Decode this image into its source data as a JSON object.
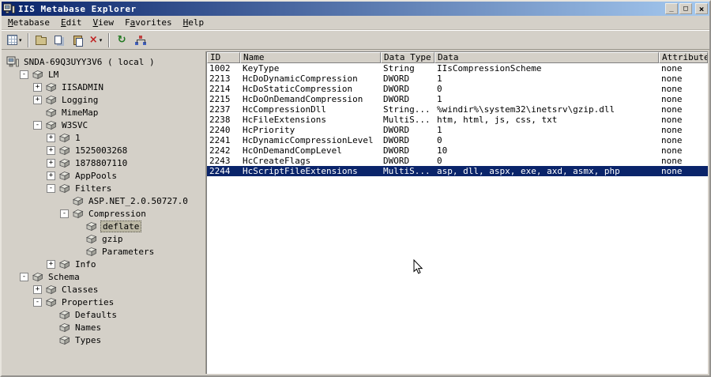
{
  "window": {
    "title": "IIS Metabase Explorer",
    "controls": [
      {
        "name": "minimize",
        "glyph": "_"
      },
      {
        "name": "restore",
        "glyph": "□"
      },
      {
        "name": "close",
        "glyph": "×"
      }
    ]
  },
  "menu": {
    "items": [
      {
        "label": "Metabase",
        "u": 0
      },
      {
        "label": "Edit",
        "u": 0
      },
      {
        "label": "View",
        "u": 0
      },
      {
        "label": "Favorites",
        "u": 1
      },
      {
        "label": "Help",
        "u": 0
      }
    ]
  },
  "toolbar": {
    "buttons": [
      {
        "name": "new-record",
        "icon": "newrecord",
        "dropdown": true
      },
      {
        "type": "separator"
      },
      {
        "name": "open",
        "icon": "folder"
      },
      {
        "name": "copy",
        "icon": "copy"
      },
      {
        "name": "paste",
        "icon": "paste"
      },
      {
        "name": "delete",
        "icon": "delete",
        "glyph": "×",
        "color": "#c02020",
        "dropdown": true
      },
      {
        "type": "separator"
      },
      {
        "name": "refresh",
        "icon": "refresh",
        "glyph": "↻",
        "color": "#207820"
      },
      {
        "name": "network",
        "icon": "network"
      }
    ]
  },
  "tree": {
    "items": [
      {
        "label": "SNDA-69Q3UYY3V6 ( local )",
        "depth": 0,
        "expander": "none",
        "icon": "computer"
      },
      {
        "label": "LM",
        "depth": 1,
        "expander": "minus",
        "icon": "key"
      },
      {
        "label": "IISADMIN",
        "depth": 2,
        "expander": "plus",
        "icon": "key"
      },
      {
        "label": "Logging",
        "depth": 2,
        "expander": "plus",
        "icon": "key"
      },
      {
        "label": "MimeMap",
        "depth": 2,
        "expander": "none",
        "icon": "key"
      },
      {
        "label": "W3SVC",
        "depth": 2,
        "expander": "minus",
        "icon": "key"
      },
      {
        "label": "1",
        "depth": 3,
        "expander": "plus",
        "icon": "key"
      },
      {
        "label": "1525003268",
        "depth": 3,
        "expander": "plus",
        "icon": "key"
      },
      {
        "label": "1878807110",
        "depth": 3,
        "expander": "plus",
        "icon": "key"
      },
      {
        "label": "AppPools",
        "depth": 3,
        "expander": "plus",
        "icon": "key"
      },
      {
        "label": "Filters",
        "depth": 3,
        "expander": "minus",
        "icon": "key"
      },
      {
        "label": "ASP.NET_2.0.50727.0",
        "depth": 4,
        "expander": "none",
        "icon": "key"
      },
      {
        "label": "Compression",
        "depth": 4,
        "expander": "minus",
        "icon": "key"
      },
      {
        "label": "deflate",
        "depth": 5,
        "expander": "none",
        "icon": "key",
        "selected": true
      },
      {
        "label": "gzip",
        "depth": 5,
        "expander": "none",
        "icon": "key"
      },
      {
        "label": "Parameters",
        "depth": 5,
        "expander": "none",
        "icon": "key"
      },
      {
        "label": "Info",
        "depth": 3,
        "expander": "plus",
        "icon": "key"
      },
      {
        "label": "Schema",
        "depth": 1,
        "expander": "minus",
        "icon": "key"
      },
      {
        "label": "Classes",
        "depth": 2,
        "expander": "plus",
        "icon": "key"
      },
      {
        "label": "Properties",
        "depth": 2,
        "expander": "minus",
        "icon": "key"
      },
      {
        "label": "Defaults",
        "depth": 3,
        "expander": "none",
        "icon": "key"
      },
      {
        "label": "Names",
        "depth": 3,
        "expander": "none",
        "icon": "key"
      },
      {
        "label": "Types",
        "depth": 3,
        "expander": "none",
        "icon": "key"
      }
    ]
  },
  "table": {
    "columns": [
      "ID",
      "Name",
      "Data Type",
      "Data",
      "Attributes"
    ],
    "rows": [
      {
        "cells": [
          "1002",
          "KeyType",
          "String",
          "IIsCompressionScheme",
          "none"
        ]
      },
      {
        "cells": [
          "2213",
          "HcDoDynamicCompression",
          "DWORD",
          "1",
          "none"
        ]
      },
      {
        "cells": [
          "2214",
          "HcDoStaticCompression",
          "DWORD",
          "0",
          "none"
        ]
      },
      {
        "cells": [
          "2215",
          "HcDoOnDemandCompression",
          "DWORD",
          "1",
          "none"
        ]
      },
      {
        "cells": [
          "2237",
          "HcCompressionDll",
          "String...",
          "%windir%\\system32\\inetsrv\\gzip.dll",
          "none"
        ]
      },
      {
        "cells": [
          "2238",
          "HcFileExtensions",
          "MultiS...",
          "htm, html, js, css, txt",
          "none"
        ]
      },
      {
        "cells": [
          "2240",
          "HcPriority",
          "DWORD",
          "1",
          "none"
        ]
      },
      {
        "cells": [
          "2241",
          "HcDynamicCompressionLevel",
          "DWORD",
          "0",
          "none"
        ]
      },
      {
        "cells": [
          "2242",
          "HcOnDemandCompLevel",
          "DWORD",
          "10",
          "none"
        ]
      },
      {
        "cells": [
          "2243",
          "HcCreateFlags",
          "DWORD",
          "0",
          "none"
        ]
      },
      {
        "cells": [
          "2244",
          "HcScriptFileExtensions",
          "MultiS...",
          "asp, dll, aspx, exe, axd, asmx, php",
          "none"
        ],
        "selected": true
      }
    ]
  },
  "colors": {
    "titlebar_start": "#0a246a",
    "titlebar_end": "#a6caf0",
    "selection": "#0a246a",
    "window_bg": "#d4d0c8"
  }
}
